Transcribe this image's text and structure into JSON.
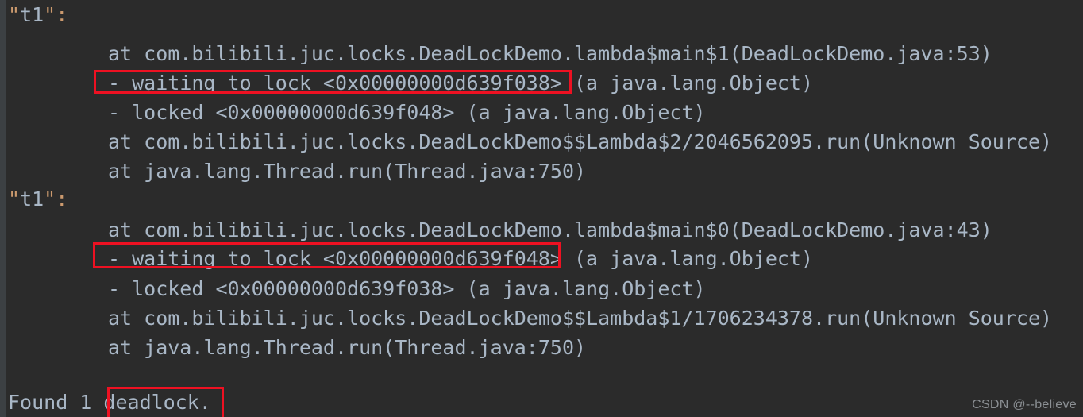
{
  "theme": {
    "console_bg": "#2b2b2b",
    "gutter_bg": "#3c4043",
    "text_color": "#a9b7c6",
    "quote_color": "#cc9a6e",
    "highlight_border": "#ee1122",
    "watermark_color": "#8b8f93"
  },
  "console": {
    "title": "Thread dump deadlock output",
    "lines": [
      {
        "id": "thread-1-header",
        "indent": 0,
        "kind": "thread-name",
        "quote": "\"",
        "name": "t1",
        "suffix": "\":"
      },
      {
        "id": "thread-1-frame-1",
        "indent": 1,
        "kind": "stack-frame",
        "text": "at com.bilibili.juc.locks.DeadLockDemo.lambda$main$1(DeadLockDemo.java:53)"
      },
      {
        "id": "thread-1-waiting",
        "indent": 1,
        "kind": "lock-waiting",
        "text": "- waiting to lock <0x00000000d639f038> (a java.lang.Object)"
      },
      {
        "id": "thread-1-locked",
        "indent": 1,
        "kind": "lock-held",
        "text": "- locked <0x00000000d639f048> (a java.lang.Object)"
      },
      {
        "id": "thread-1-frame-2",
        "indent": 1,
        "kind": "stack-frame",
        "text": "at com.bilibili.juc.locks.DeadLockDemo$$Lambda$2/2046562095.run(Unknown Source)"
      },
      {
        "id": "thread-1-frame-3",
        "indent": 1,
        "kind": "stack-frame",
        "text": "at java.lang.Thread.run(Thread.java:750)"
      },
      {
        "id": "thread-2-header",
        "indent": 0,
        "kind": "thread-name",
        "quote": "\"",
        "name": "t1",
        "suffix": "\":"
      },
      {
        "id": "thread-2-frame-1",
        "indent": 1,
        "kind": "stack-frame",
        "text": "at com.bilibili.juc.locks.DeadLockDemo.lambda$main$0(DeadLockDemo.java:43)"
      },
      {
        "id": "thread-2-waiting",
        "indent": 1,
        "kind": "lock-waiting",
        "text": "- waiting to lock <0x00000000d639f048> (a java.lang.Object)"
      },
      {
        "id": "thread-2-locked",
        "indent": 1,
        "kind": "lock-held",
        "text": "- locked <0x00000000d639f038> (a java.lang.Object)"
      },
      {
        "id": "thread-2-frame-2",
        "indent": 1,
        "kind": "stack-frame",
        "text": "at com.bilibili.juc.locks.DeadLockDemo$$Lambda$1/1706234378.run(Unknown Source)"
      },
      {
        "id": "thread-2-frame-3",
        "indent": 1,
        "kind": "stack-frame",
        "text": "at java.lang.Thread.run(Thread.java:750)"
      },
      {
        "id": "blank-line",
        "indent": 0,
        "kind": "blank",
        "text": ""
      },
      {
        "id": "summary-line",
        "indent": 0,
        "kind": "summary",
        "text": "Found 1 deadlock."
      }
    ]
  },
  "annotations": [
    {
      "id": "box-waiting-1",
      "label": "highlight around first waiting-to-lock line"
    },
    {
      "id": "box-waiting-2",
      "label": "highlight around second waiting-to-lock line"
    },
    {
      "id": "box-deadlock-word",
      "label": "highlight around the word deadlock."
    }
  ],
  "watermark": {
    "text": "CSDN @--believe"
  }
}
